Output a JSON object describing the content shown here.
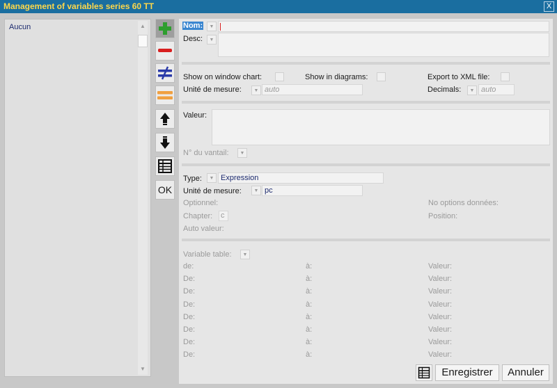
{
  "window": {
    "title": "Management of variables series 60 TT",
    "close": "X"
  },
  "list": {
    "items": [
      "Aucun"
    ]
  },
  "toolbar": {
    "ok_label": "OK",
    "colors": {
      "add": "#2e9e2e",
      "remove": "#d81f1f",
      "not_equal": "#2a3aa8",
      "equal": "#f0a040"
    }
  },
  "form": {
    "nom_label": "Nom:",
    "desc_label": "Desc:",
    "show_window_chart": "Show on window chart:",
    "show_diagrams": "Show in diagrams:",
    "export_xml": "Export to XML file:",
    "unite_mesure_label": "Unité de mesure:",
    "unite_mesure_value": "auto",
    "decimals_label": "Decimals:",
    "decimals_value": "auto",
    "valeur_label": "Valeur:",
    "vantail_label": "N° du vantail:",
    "type_label": "Type:",
    "type_value": "Expression",
    "unite2_label": "Unité de mesure:",
    "unite2_value": "pc",
    "optionnel": "Optionnel:",
    "no_options": "No options données:",
    "chapter_label": "Chapter:",
    "chapter_value": "c",
    "position": "Position:",
    "auto_valeur": "Auto valeur:",
    "variable_table": "Variable table:"
  },
  "table_rows": [
    {
      "from": "de:",
      "to": "à:",
      "value": "Valeur:"
    },
    {
      "from": "De:",
      "to": "à:",
      "value": "Valeur:"
    },
    {
      "from": "De:",
      "to": "à:",
      "value": "Valeur:"
    },
    {
      "from": "De:",
      "to": "à:",
      "value": "Valeur:"
    },
    {
      "from": "De:",
      "to": "à:",
      "value": "Valeur:"
    },
    {
      "from": "De:",
      "to": "à:",
      "value": "Valeur:"
    },
    {
      "from": "De:",
      "to": "à:",
      "value": "Valeur:"
    },
    {
      "from": "De:",
      "to": "à:",
      "value": "Valeur:"
    }
  ],
  "buttons": {
    "save": "Enregistrer",
    "cancel": "Annuler"
  }
}
